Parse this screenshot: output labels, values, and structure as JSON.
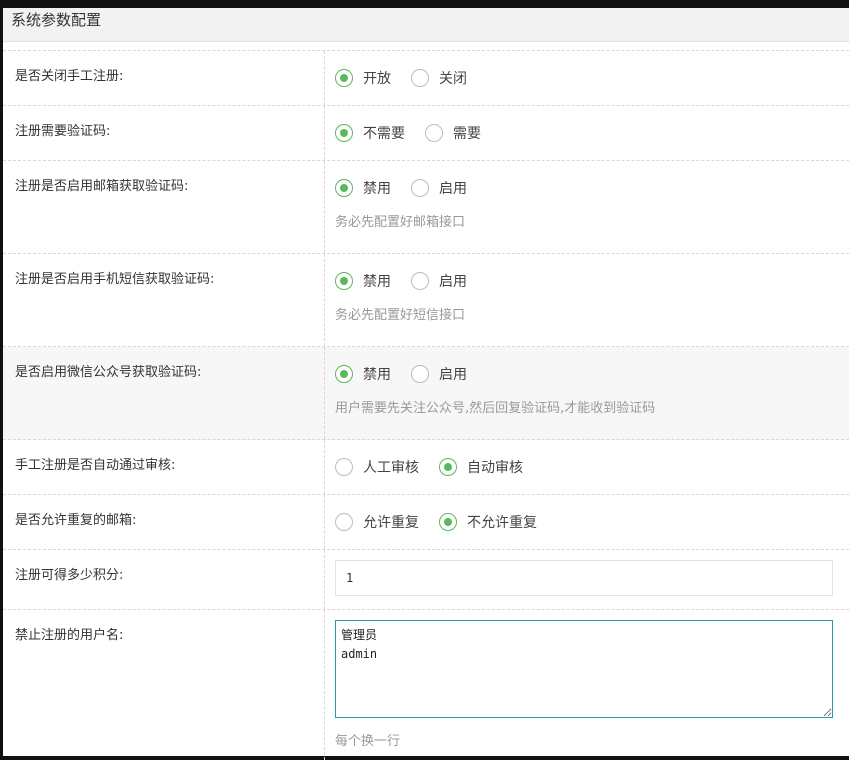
{
  "panel": {
    "title": "系统参数配置"
  },
  "rows": [
    {
      "label": "是否关闭手工注册:",
      "options": [
        {
          "label": "开放",
          "checked": true
        },
        {
          "label": "关闭",
          "checked": false
        }
      ]
    },
    {
      "label": "注册需要验证码:",
      "options": [
        {
          "label": "不需要",
          "checked": true
        },
        {
          "label": "需要",
          "checked": false
        }
      ]
    },
    {
      "label": "注册是否启用邮箱获取验证码:",
      "options": [
        {
          "label": "禁用",
          "checked": true
        },
        {
          "label": "启用",
          "checked": false
        }
      ],
      "hint": "务必先配置好邮箱接口"
    },
    {
      "label": "注册是否启用手机短信获取验证码:",
      "options": [
        {
          "label": "禁用",
          "checked": true
        },
        {
          "label": "启用",
          "checked": false
        }
      ],
      "hint": "务必先配置好短信接口"
    },
    {
      "label": "是否启用微信公众号获取验证码:",
      "options": [
        {
          "label": "禁用",
          "checked": true
        },
        {
          "label": "启用",
          "checked": false
        }
      ],
      "hint": "用户需要先关注公众号,然后回复验证码,才能收到验证码"
    },
    {
      "label": "手工注册是否自动通过审核:",
      "options": [
        {
          "label": "人工审核",
          "checked": false
        },
        {
          "label": "自动审核",
          "checked": true
        }
      ]
    },
    {
      "label": "是否允许重复的邮箱:",
      "options": [
        {
          "label": "允许重复",
          "checked": false
        },
        {
          "label": "不允许重复",
          "checked": true
        }
      ]
    },
    {
      "label": "注册可得多少积分:",
      "value": "1"
    },
    {
      "label": "禁止注册的用户名:",
      "value": "管理员\nadmin",
      "hint": "每个换一行"
    }
  ],
  "colors": {
    "accent": "#5cb85c",
    "focus_border": "#2b99a8"
  }
}
